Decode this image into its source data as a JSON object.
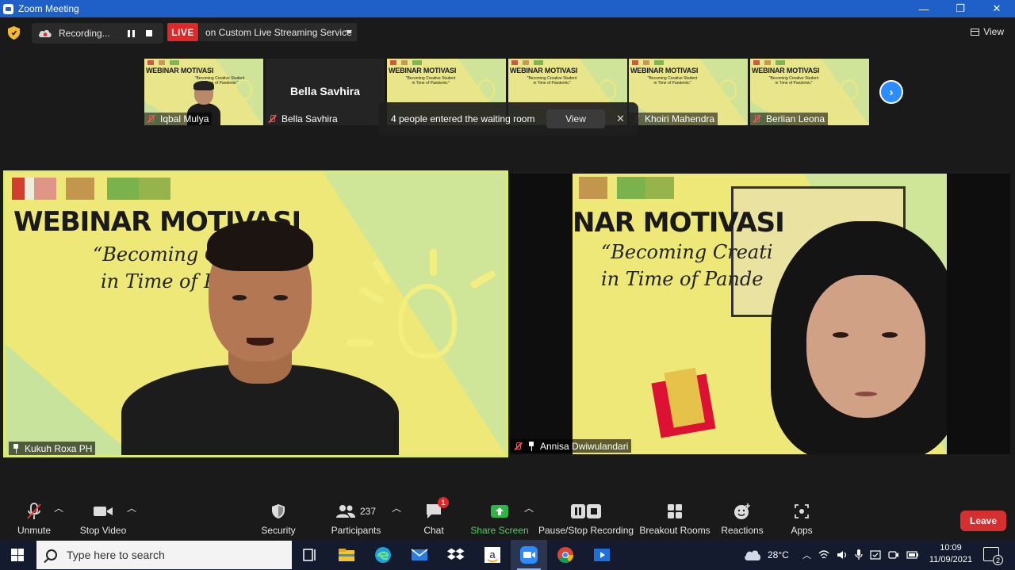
{
  "window": {
    "title": "Zoom Meeting",
    "controls": [
      "—",
      "❐",
      "✕"
    ]
  },
  "topbar": {
    "recording_label": "Recording...",
    "live_label": "LIVE",
    "live_service": "on Custom Live Streaming Service",
    "view_label": "View"
  },
  "thumbnails": [
    {
      "name": "Iqbal Mulya",
      "kind": "video-slide-person"
    },
    {
      "name": "Bella Savhira",
      "kind": "avatar-name",
      "big_name": "Bella Savhira"
    },
    {
      "name": "",
      "kind": "video-slide"
    },
    {
      "name": "",
      "kind": "video-slide"
    },
    {
      "name": "Khoiri Mahendra",
      "kind": "video-slide"
    },
    {
      "name": "Berlian Leona",
      "kind": "video-slide"
    }
  ],
  "slide_text": {
    "title": "WEBINAR MOTIVASI",
    "subtitle_line1": "\"Becoming Creative Student",
    "subtitle_line2": "in Time of Pandemic\""
  },
  "main_slide_text": {
    "left_title": "WEBINAR MOTIVASI",
    "left_sub1": "“Becoming Creat",
    "left_sub2": "in Time of Pand",
    "right_title": "NAR MOTIVASI",
    "right_sub1": "“Becoming Creati",
    "right_sub2": "in Time of Pande"
  },
  "toast": {
    "message": "4 people entered the waiting room",
    "view_label": "View",
    "close_label": "✕"
  },
  "videos": [
    {
      "name": "Kukuh Roxa PH",
      "active_speaker": true
    },
    {
      "name": "Annisa Dwiwulandari",
      "active_speaker": false
    }
  ],
  "toolbar": {
    "unmute": "Unmute",
    "stop_video": "Stop Video",
    "security": "Security",
    "participants": "Participants",
    "participants_count": "237",
    "chat": "Chat",
    "chat_badge": "1",
    "share_screen": "Share Screen",
    "pause_stop_recording": "Pause/Stop Recording",
    "breakout_rooms": "Breakout Rooms",
    "reactions": "Reactions",
    "apps": "Apps",
    "leave": "Leave"
  },
  "taskbar": {
    "search_placeholder": "Type here to search",
    "temperature": "28°C",
    "time": "10:09",
    "date": "11/09/2021",
    "notification_count": "2"
  },
  "colors": {
    "title_bar": "#1e5fc8",
    "live_red": "#e02828",
    "share_green": "#2fb544",
    "accent_blue": "#2d8cff",
    "active_speaker_border": "#ddec6a",
    "slide_yellow": "#ede877"
  },
  "icons": [
    "shield-icon",
    "cloud-icon",
    "pause-icon",
    "stop-icon",
    "grid-icon",
    "mic-muted-icon",
    "camera-icon",
    "shield-icon",
    "participants-icon",
    "chat-icon",
    "share-arrow-icon",
    "record-icon",
    "breakout-icon",
    "smiley-icon",
    "apps-icon",
    "windows-icon",
    "search-icon"
  ]
}
